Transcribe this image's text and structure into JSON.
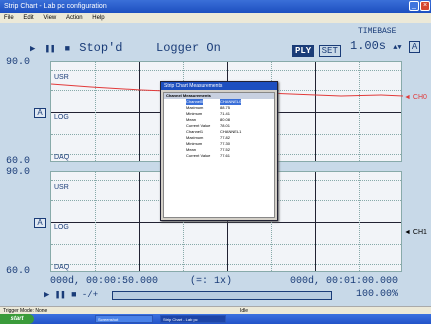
{
  "window": {
    "title": "Strip Chart - Lab pc configuration"
  },
  "menu": [
    "File",
    "Edit",
    "View",
    "Action",
    "Help"
  ],
  "controls": {
    "status": "Stop'd",
    "logger": "Logger On",
    "ply": "PLY",
    "set": "SET",
    "timebase_label": "TIMEBASE",
    "timebase_value": "1.00s",
    "timebase_a": "A"
  },
  "chart_top": {
    "y_max": "90.0",
    "y_min": "60.0",
    "usr": "USR",
    "log": "LOG",
    "daq": "DAQ",
    "a_btn": "A",
    "channel": "CH0"
  },
  "chart_bottom": {
    "y_max": "90.0",
    "y_min": "60.0",
    "usr": "USR",
    "log": "LOG",
    "daq": "DAQ",
    "a_btn": "A",
    "channel": "CH1"
  },
  "timeline": {
    "start": "000d, 00:00:50.000",
    "zoom": "(=:   1x)",
    "end": "000d, 00:01:00.000",
    "scroll_label": "-/+",
    "percent": "100.00%"
  },
  "panel": {
    "title": "Strip Chart Measurements",
    "header": "Channel Measurements",
    "rows": [
      {
        "k": "Channel0",
        "v": "CHANNEL0",
        "sel": true
      },
      {
        "k": "Maximum",
        "v": "88.75"
      },
      {
        "k": "Minimum",
        "v": "71.41"
      },
      {
        "k": "Mean",
        "v": "80.08"
      },
      {
        "k": "Current Value",
        "v": "78.01"
      },
      {
        "k": "Channel1",
        "v": "CHANNEL1"
      },
      {
        "k": "Maximum",
        "v": "77.82"
      },
      {
        "k": "Minimum",
        "v": "77.30"
      },
      {
        "k": "Mean",
        "v": "77.52"
      },
      {
        "k": "Current Value",
        "v": "77.61"
      }
    ]
  },
  "statusbar": {
    "left": "Trigger Mode: None",
    "mid": "Idle"
  },
  "taskbar": {
    "start": "start",
    "tasks": [
      "Screenshot",
      "Strip Chart - Lab pc"
    ]
  },
  "colors": {
    "accent": "#1a3c78",
    "trace_ch0": "#e23a3a",
    "marker_ch1": "#000000"
  }
}
